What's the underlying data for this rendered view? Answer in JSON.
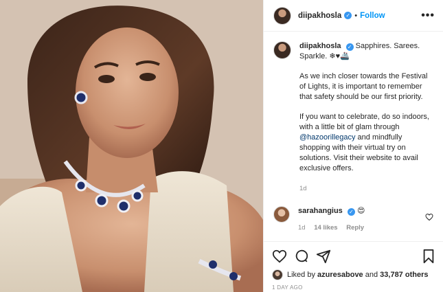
{
  "header": {
    "username": "diipakhosla",
    "separator": "•",
    "follow_label": "Follow",
    "more_label": "•••"
  },
  "caption": {
    "username": "diipakhosla",
    "headline": "Sapphires. Sarees. Sparkle. ❄♥🚢",
    "paragraph1": "As we inch closer towards the Festival of Lights, it is important to remember that safety should be our first priority.",
    "paragraph2_start": "If you want to celebrate, do so indoors, with a little bit of glam through ",
    "mention": "@hazoorillegacy",
    "paragraph2_end": " and mindfully shopping with their virtual try on solutions. Visit their website to avail exclusive offers.",
    "age": "1d"
  },
  "comment": {
    "username": "sarahangius",
    "text": "😍",
    "age": "1d",
    "likes": "14 likes",
    "reply_label": "Reply"
  },
  "likes": {
    "prefix": "Liked by ",
    "user": "azuresabove",
    "middle": " and ",
    "others": "33,787 others"
  },
  "date": "1 DAY AGO",
  "icons": {
    "verified": "verified-badge",
    "like": "heart-icon",
    "comment": "comment-icon",
    "share": "share-icon",
    "save": "bookmark-icon",
    "comment_like": "heart-icon"
  },
  "colors": {
    "follow": "#0095f6",
    "verified": "#3897f0",
    "mention": "#00376b",
    "muted": "#8e8e8e"
  }
}
